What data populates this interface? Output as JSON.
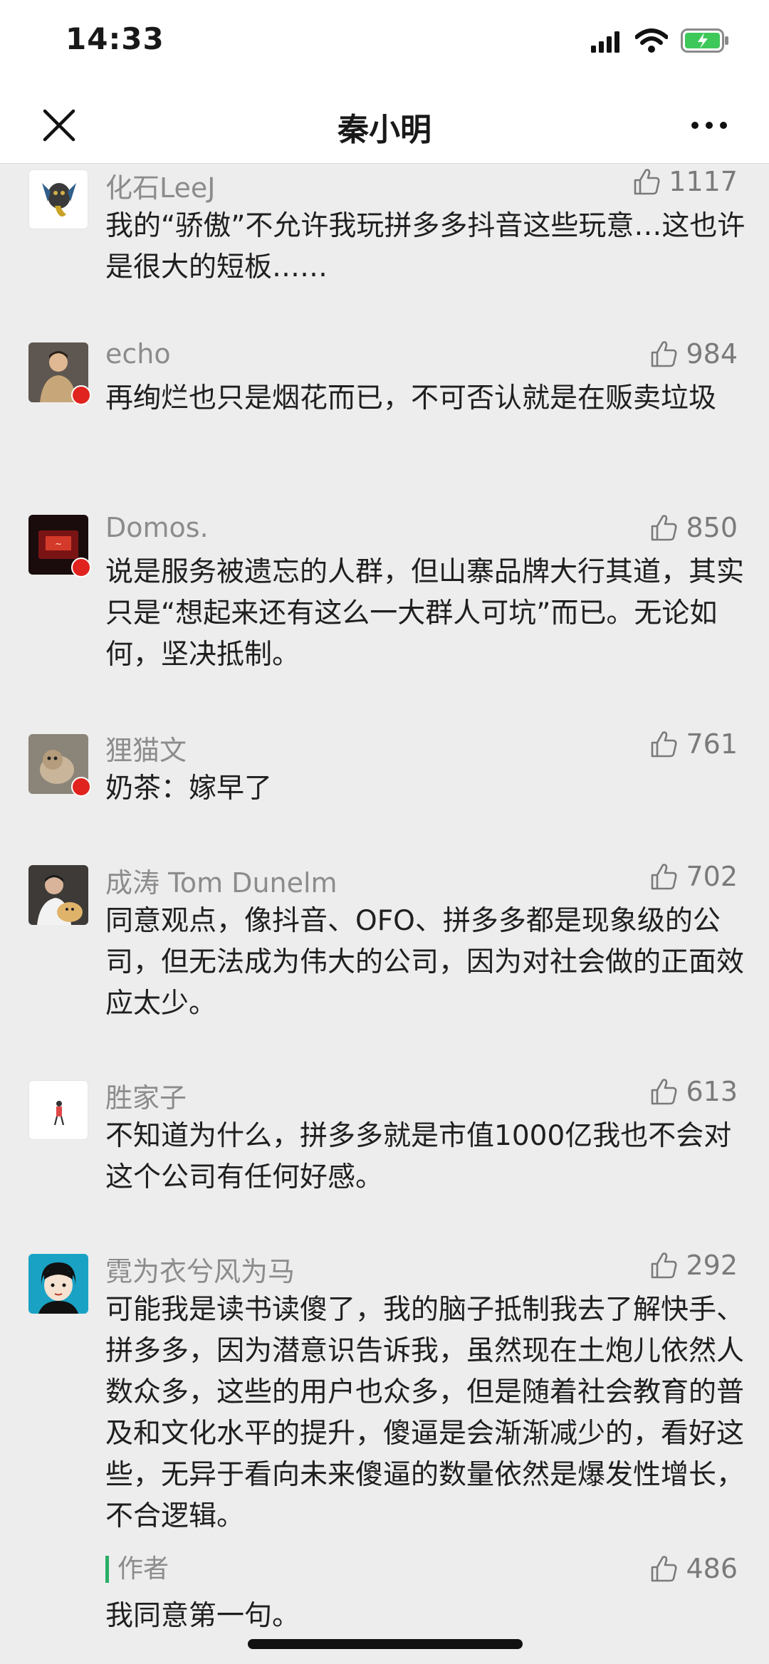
{
  "status_bar": {
    "time": "14:33"
  },
  "nav": {
    "title": "秦小明"
  },
  "comments": [
    {
      "name": "化石LeeJ",
      "likes": "1117",
      "text": "我的“骄傲”不允许我玩拼多多抖音这些玩意…这也许是很大的短板……"
    },
    {
      "name": "echo",
      "likes": "984",
      "text": "再绚烂也只是烟花而已，不可否认就是在贩卖垃圾"
    },
    {
      "name": "Domos.",
      "likes": "850",
      "text": "说是服务被遗忘的人群，但山寨品牌大行其道，其实只是“想起来还有这么一大群人可坑”而已。无论如何，坚决抵制。"
    },
    {
      "name": "狸猫文",
      "likes": "761",
      "text": "奶茶：嫁早了"
    },
    {
      "name": "成涛 Tom Dunelm",
      "likes": "702",
      "text": "同意观点，像抖音、OFO、拼多多都是现象级的公司，但无法成为伟大的公司，因为对社会做的正面效应太少。"
    },
    {
      "name": "胜家子",
      "likes": "613",
      "text": "不知道为什么，拼多多就是市值1000亿我也不会对这个公司有任何好感。"
    },
    {
      "name": "霓为衣兮风为马",
      "likes": "292",
      "text": "可能我是读书读傻了，我的脑子抵制我去了解快手、拼多多，因为潜意识告诉我，虽然现在土炮儿依然人数众多，这些的用户也众多，但是随着社会教育的普及和文化水平的提升，傻逼是会渐渐减少的，看好这些，无异于看向未来傻逼的数量依然是爆发性增长，不合逻辑。"
    }
  ],
  "author_reply": {
    "tag": "作者",
    "likes": "486",
    "text": "我同意第一句。"
  }
}
